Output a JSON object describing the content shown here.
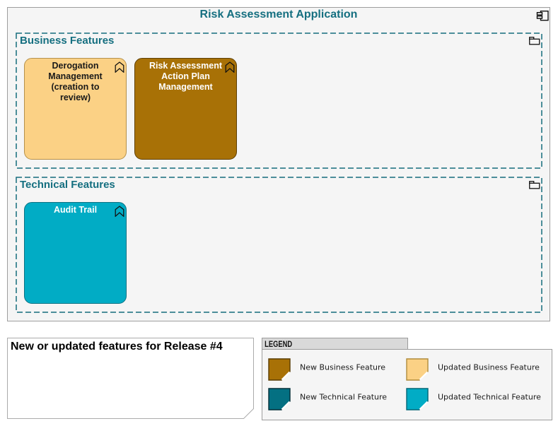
{
  "colors": {
    "teal_text": "#156F80",
    "teal_border": "#156C7D",
    "canvas_fill": "#F5F5F5",
    "canvas_border": "#9E9E9E",
    "icon_ink": "#111111",
    "text_dark": "#1A1A1A",
    "text_white": "#FFFFFF",
    "new_business": "#A87106",
    "new_business_border": "#5E3F04",
    "updated_business": "#FBD185",
    "updated_business_border": "#B5914B",
    "new_technical": "#047082",
    "new_technical_border": "#063B45",
    "updated_technical": "#01ACC5",
    "updated_technical_border": "#0B7183",
    "note_fill": "#FFFFFF",
    "note_border": "#ABABAB",
    "legend_header_fill": "#D9D9D9",
    "legend_body_fill": "#F5F5F5"
  },
  "application": {
    "title": "Risk Assessment Application",
    "groups": [
      {
        "title": "Business Features",
        "features": [
          {
            "label": "Derogation\nManagement\n(creation to\nreview)"
          },
          {
            "label": "Risk Assessment\nAction Plan\nManagement"
          }
        ]
      },
      {
        "title": "Technical Features",
        "features": [
          {
            "label": "Audit Trail"
          }
        ]
      }
    ]
  },
  "note": {
    "text": "New or updated features for Release #4"
  },
  "legend": {
    "title": "LEGEND",
    "items": [
      {
        "label": "New Business Feature",
        "color": "#A87106",
        "border": "#593D03"
      },
      {
        "label": "Updated Business Feature",
        "color": "#FBD185",
        "border": "#B08C3C"
      },
      {
        "label": "New Technical Feature",
        "color": "#047082",
        "border": "#032E38"
      },
      {
        "label": "Updated Technical Feature",
        "color": "#01ACC5",
        "border": "#026676"
      }
    ]
  }
}
